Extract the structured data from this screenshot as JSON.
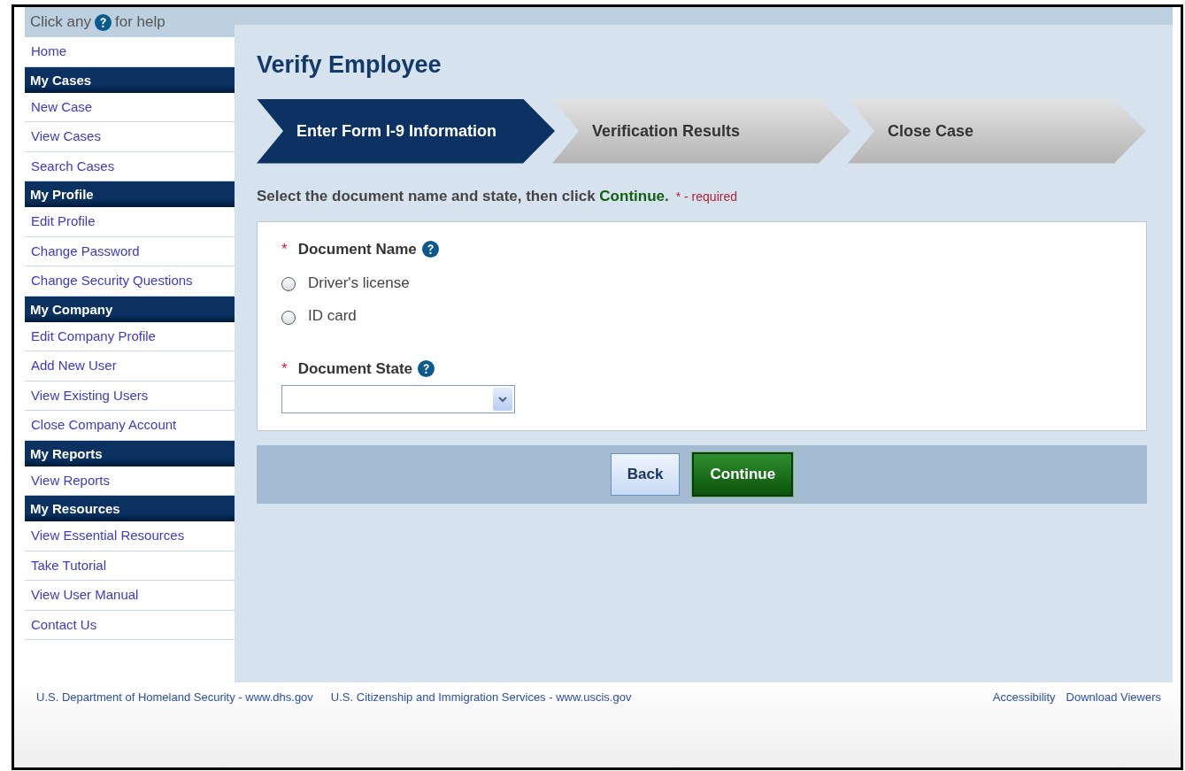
{
  "help_bar": {
    "before": "Click any",
    "after": "for help"
  },
  "sidebar": {
    "items": [
      {
        "kind": "link",
        "label": "Home"
      },
      {
        "kind": "header",
        "label": "My Cases"
      },
      {
        "kind": "link",
        "label": "New Case"
      },
      {
        "kind": "link",
        "label": "View Cases"
      },
      {
        "kind": "link",
        "label": "Search Cases"
      },
      {
        "kind": "header",
        "label": "My Profile"
      },
      {
        "kind": "link",
        "label": "Edit Profile"
      },
      {
        "kind": "link",
        "label": "Change Password"
      },
      {
        "kind": "link",
        "label": "Change Security Questions"
      },
      {
        "kind": "header",
        "label": "My Company"
      },
      {
        "kind": "link",
        "label": "Edit Company Profile"
      },
      {
        "kind": "link",
        "label": "Add New User"
      },
      {
        "kind": "link",
        "label": "View Existing Users"
      },
      {
        "kind": "link",
        "label": "Close Company Account"
      },
      {
        "kind": "header",
        "label": "My Reports"
      },
      {
        "kind": "link",
        "label": "View Reports"
      },
      {
        "kind": "header",
        "label": "My Resources"
      },
      {
        "kind": "link",
        "label": "View Essential Resources"
      },
      {
        "kind": "link",
        "label": "Take Tutorial"
      },
      {
        "kind": "link",
        "label": "View User Manual"
      },
      {
        "kind": "link",
        "label": "Contact Us"
      }
    ]
  },
  "page_title": "Verify Employee",
  "steps": [
    {
      "label": "Enter Form I-9 Information",
      "selected": true
    },
    {
      "label": "Verification Results",
      "selected": false
    },
    {
      "label": "Close Case",
      "selected": false
    }
  ],
  "instruction": {
    "text": "Select the document name and state, then click",
    "highlight": "Continue",
    "tail": ".",
    "required_note": "* - required"
  },
  "fields": [
    {
      "kind": "radio",
      "required_mark": "*",
      "label": "Document Name",
      "options": [
        {
          "label": "Driver's license",
          "selected": false
        },
        {
          "label": "ID card",
          "selected": false
        }
      ]
    },
    {
      "kind": "select",
      "required_mark": "*",
      "label": "Document State"
    }
  ],
  "buttons": [
    {
      "kind": "secondary",
      "label": "Back"
    },
    {
      "kind": "primary",
      "label": "Continue"
    }
  ],
  "footer": {
    "left": [
      "U.S. Department of Homeland Security - www.dhs.gov",
      "U.S. Citizenship and Immigration Services - www.uscis.gov"
    ],
    "right": [
      "Accessibility",
      "Download Viewers"
    ]
  }
}
